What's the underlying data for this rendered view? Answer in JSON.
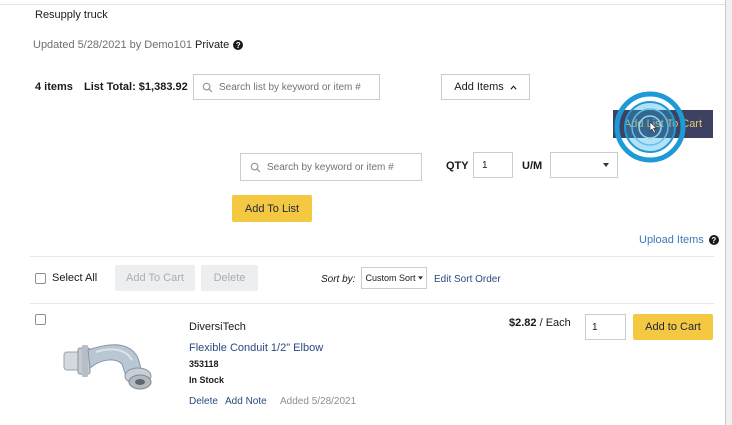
{
  "list": {
    "name": "Resupply truck",
    "updated": "Updated 5/28/2021 by Demo101",
    "privacy": "Private",
    "item_count": "4 items",
    "total": "List Total: $1,383.92"
  },
  "toolbar": {
    "search_placeholder": "Search list by keyword or item #",
    "add_items_label": "Add Items",
    "add_list_to_cart_label": "Add List To Cart"
  },
  "add_panel": {
    "search_placeholder": "Search by keyword or item #",
    "qty_label": "QTY",
    "qty_value": "1",
    "um_label": "U/M",
    "um_value": "",
    "add_to_list_label": "Add To List",
    "upload_items_label": "Upload Items"
  },
  "actions_bar": {
    "select_all_label": "Select All",
    "add_to_cart_label": "Add To Cart",
    "delete_label": "Delete",
    "sort_by_label": "Sort by:",
    "sort_value": "Custom Sort",
    "edit_sort_label": "Edit Sort Order"
  },
  "items": [
    {
      "brand": "DiversiTech",
      "name": "Flexible Conduit 1/2\" Elbow",
      "sku": "353118",
      "stock": "In Stock",
      "price": "$2.82",
      "unit": "/ Each",
      "qty": "1",
      "add_to_cart_label": "Add to Cart",
      "delete_label": "Delete",
      "add_note_label": "Add Note",
      "added": "Added 5/28/2021"
    }
  ],
  "colors": {
    "accent_yellow": "#f5c842",
    "navy": "#3d4263",
    "link_blue": "#2a4a7f",
    "cursor_highlight": "#1e9bd7"
  }
}
